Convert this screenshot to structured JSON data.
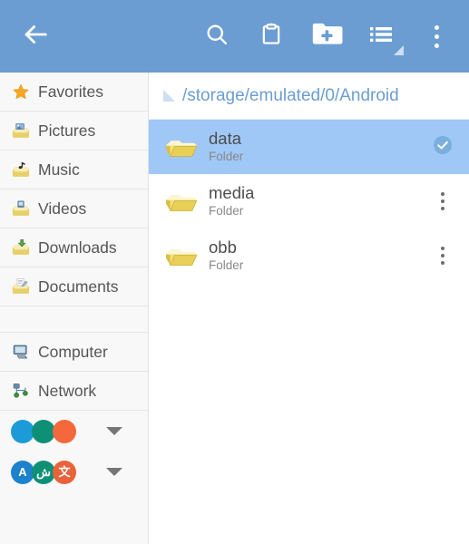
{
  "toolbar": {
    "back_label": "Back",
    "back_icon": "arrow-left-icon",
    "search_label": "Search",
    "search_icon": "search-icon",
    "clipboard_label": "Clipboard",
    "clipboard_icon": "clipboard-icon",
    "new_folder_label": "New folder",
    "new_folder_icon": "folder-add-icon",
    "view_mode_label": "View mode",
    "view_mode_icon": "list-view-icon",
    "overflow_label": "More options",
    "overflow_icon": "more-vertical-icon",
    "background_color": "#6b9dd2"
  },
  "sidebar": {
    "items": [
      {
        "label": "Favorites",
        "icon": "star-icon"
      },
      {
        "label": "Pictures",
        "icon": "folder-pictures-icon"
      },
      {
        "label": "Music",
        "icon": "folder-music-icon"
      },
      {
        "label": "Videos",
        "icon": "folder-videos-icon"
      },
      {
        "label": "Downloads",
        "icon": "folder-downloads-icon"
      },
      {
        "label": "Documents",
        "icon": "folder-documents-icon"
      }
    ],
    "places": [
      {
        "label": "Computer",
        "icon": "computer-icon"
      },
      {
        "label": "Network",
        "icon": "network-icon"
      }
    ],
    "circle_rows": [
      {
        "name": "color-swatches",
        "circles": [
          {
            "color": "#1d9bd8",
            "glyph": ""
          },
          {
            "color": "#0e9076",
            "glyph": ""
          },
          {
            "color": "#f4683c",
            "glyph": ""
          }
        ],
        "caret": "chevron-down-icon"
      },
      {
        "name": "language-swatches",
        "circles": [
          {
            "color": "#1d82cc",
            "glyph": "A"
          },
          {
            "color": "#0e9076",
            "glyph": "ش"
          },
          {
            "color": "#e8633a",
            "glyph": "文"
          }
        ],
        "caret": "chevron-down-icon"
      }
    ]
  },
  "main": {
    "path": "/storage/emulated/0/Android",
    "path_marker_icon": "triangle-marker-icon",
    "files": [
      {
        "name": "data",
        "type": "Folder",
        "selected": true,
        "action_icon": "check-circle-icon"
      },
      {
        "name": "media",
        "type": "Folder",
        "selected": false,
        "action_icon": "more-vertical-icon"
      },
      {
        "name": "obb",
        "type": "Folder",
        "selected": false,
        "action_icon": "more-vertical-icon"
      }
    ],
    "selected_row_color": "#a0c8f7",
    "path_text_color": "#6b9dd2"
  }
}
